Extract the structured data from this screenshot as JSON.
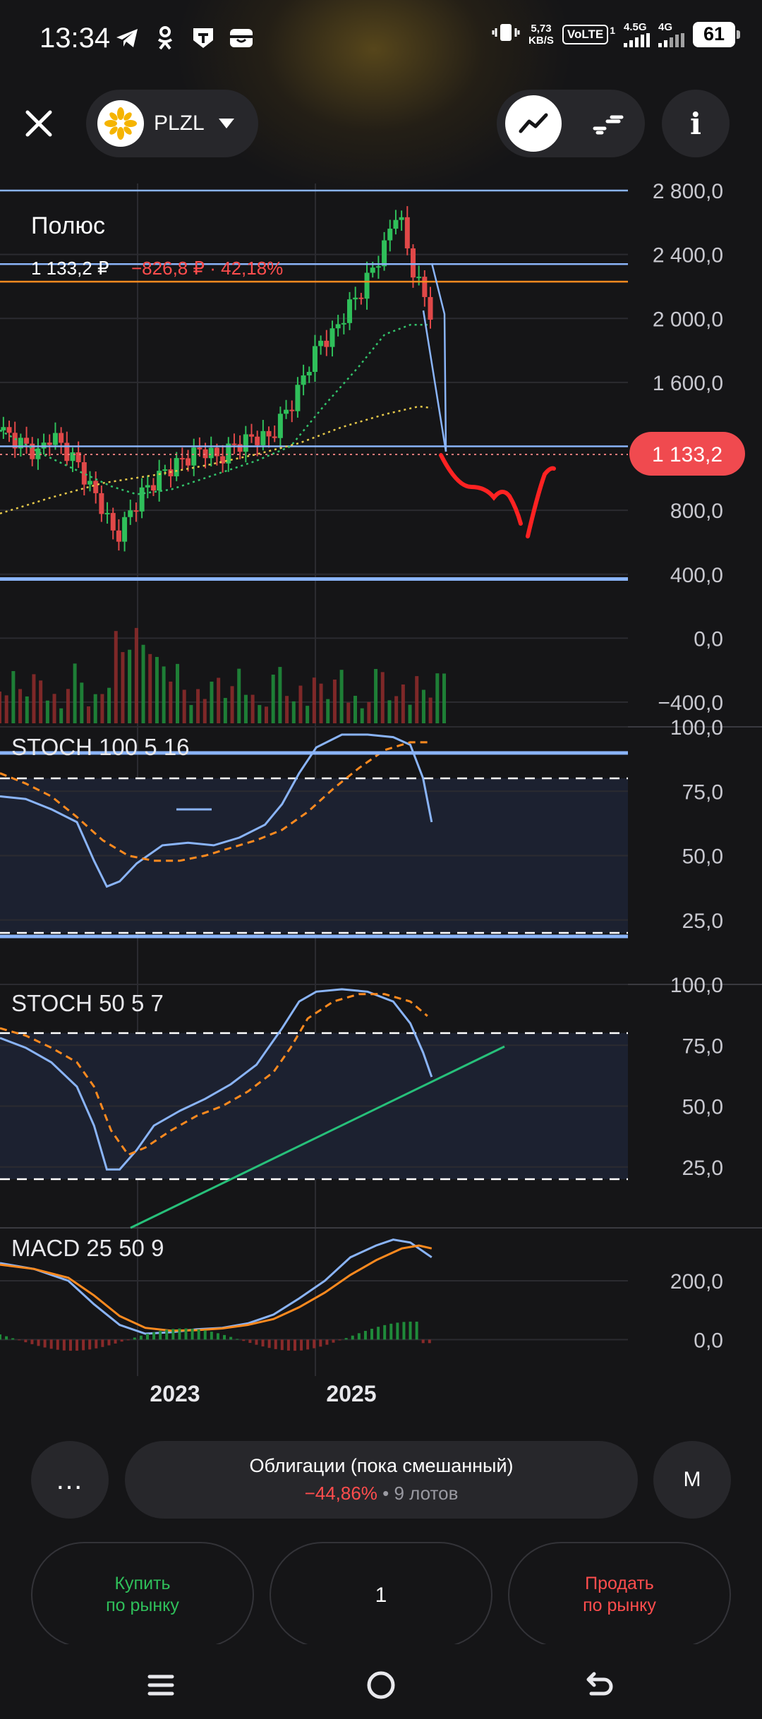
{
  "status_bar": {
    "time": "13:34",
    "net_speed_value": "5,73",
    "net_speed_unit": "KB/S",
    "volte": "VoLTE",
    "volte_sim": "1",
    "sig1_label": "4.5G",
    "sig2_label": "4G",
    "battery": "61"
  },
  "header": {
    "ticker": "PLZL"
  },
  "chart": {
    "title": "Полюс",
    "price": "1 133,2 ₽",
    "change": "−826,8 ₽ · 42,18%",
    "current_price_badge": "1 133,2",
    "colors": {
      "up": "#2fbf5a",
      "down": "#e04848",
      "accent_orange": "#ff8a1f",
      "line_blue": "#8ab4f8"
    }
  },
  "chart_data": [
    {
      "type": "candlestick",
      "title": "Полюс",
      "ylim": [
        -400,
        2800
      ],
      "y_ticks": [
        "2 800,0",
        "2 400,0",
        "2 000,0",
        "1 600,0",
        "1 200,0",
        "800,0",
        "400,0",
        "0,0",
        "−400,0"
      ],
      "x_ticks": [
        "2023",
        "2025"
      ],
      "close_series": [
        [
          0,
          1300
        ],
        [
          3,
          1250
        ],
        [
          6,
          1200
        ],
        [
          9,
          1150
        ],
        [
          12,
          1280
        ],
        [
          15,
          1180
        ],
        [
          18,
          1100
        ],
        [
          21,
          950
        ],
        [
          24,
          820
        ],
        [
          27,
          620
        ],
        [
          30,
          760
        ],
        [
          33,
          900
        ],
        [
          36,
          980
        ],
        [
          39,
          1050
        ],
        [
          42,
          1100
        ],
        [
          45,
          1150
        ],
        [
          48,
          1180
        ],
        [
          51,
          1120
        ],
        [
          54,
          1190
        ],
        [
          57,
          1230
        ],
        [
          60,
          1260
        ],
        [
          63,
          1250
        ],
        [
          66,
          1380
        ],
        [
          69,
          1500
        ],
        [
          72,
          1700
        ],
        [
          75,
          1850
        ],
        [
          78,
          1900
        ],
        [
          81,
          2050
        ],
        [
          84,
          2150
        ],
        [
          87,
          2300
        ],
        [
          90,
          2450
        ],
        [
          93,
          2700
        ],
        [
          96,
          2350
        ],
        [
          99,
          2150
        ],
        [
          102,
          1960
        ],
        [
          104,
          1133
        ]
      ],
      "horizontal_levels": [
        {
          "value": 2800,
          "color": "#8ab4f8"
        },
        {
          "value": 2340,
          "color": "#8ab4f8"
        },
        {
          "value": 2230,
          "color": "#ff8a1f"
        },
        {
          "value": 1200,
          "color": "#8ab4f8"
        },
        {
          "value": 370,
          "color": "#8ab4f8"
        }
      ]
    },
    {
      "type": "line",
      "title": "STOCH 100 5 16",
      "y_ticks": [
        "100,0",
        "75,0",
        "50,0",
        "25,0"
      ],
      "levels": [
        80,
        20
      ],
      "k": [
        [
          0,
          73
        ],
        [
          6,
          72
        ],
        [
          12,
          68
        ],
        [
          18,
          63
        ],
        [
          22,
          48
        ],
        [
          25,
          38
        ],
        [
          28,
          40
        ],
        [
          32,
          47
        ],
        [
          38,
          54
        ],
        [
          44,
          55
        ],
        [
          50,
          54
        ],
        [
          56,
          57
        ],
        [
          62,
          62
        ],
        [
          66,
          70
        ],
        [
          70,
          82
        ],
        [
          74,
          92
        ],
        [
          80,
          97
        ],
        [
          86,
          97
        ],
        [
          92,
          96
        ],
        [
          96,
          93
        ],
        [
          99,
          80
        ],
        [
          101,
          63
        ]
      ],
      "d": [
        [
          0,
          82
        ],
        [
          6,
          78
        ],
        [
          12,
          73
        ],
        [
          18,
          65
        ],
        [
          24,
          56
        ],
        [
          30,
          50
        ],
        [
          36,
          48
        ],
        [
          42,
          48
        ],
        [
          48,
          50
        ],
        [
          54,
          53
        ],
        [
          60,
          56
        ],
        [
          66,
          60
        ],
        [
          72,
          67
        ],
        [
          78,
          76
        ],
        [
          84,
          84
        ],
        [
          90,
          91
        ],
        [
          96,
          94
        ],
        [
          101,
          94
        ]
      ]
    },
    {
      "type": "line",
      "title": "STOCH 50 5 7",
      "y_ticks": [
        "100,0",
        "75,0",
        "50,0",
        "25,0"
      ],
      "levels": [
        80,
        20
      ],
      "k": [
        [
          0,
          78
        ],
        [
          6,
          74
        ],
        [
          12,
          68
        ],
        [
          18,
          58
        ],
        [
          22,
          42
        ],
        [
          25,
          24
        ],
        [
          28,
          24
        ],
        [
          32,
          32
        ],
        [
          36,
          42
        ],
        [
          42,
          48
        ],
        [
          48,
          53
        ],
        [
          54,
          59
        ],
        [
          60,
          67
        ],
        [
          66,
          82
        ],
        [
          70,
          93
        ],
        [
          74,
          97
        ],
        [
          80,
          98
        ],
        [
          86,
          97
        ],
        [
          92,
          93
        ],
        [
          96,
          84
        ],
        [
          99,
          72
        ],
        [
          101,
          62
        ]
      ],
      "d": [
        [
          0,
          82
        ],
        [
          6,
          79
        ],
        [
          12,
          74
        ],
        [
          18,
          68
        ],
        [
          22,
          58
        ],
        [
          26,
          40
        ],
        [
          30,
          30
        ],
        [
          34,
          33
        ],
        [
          40,
          40
        ],
        [
          46,
          46
        ],
        [
          52,
          50
        ],
        [
          58,
          56
        ],
        [
          64,
          64
        ],
        [
          68,
          74
        ],
        [
          72,
          86
        ],
        [
          78,
          93
        ],
        [
          84,
          96
        ],
        [
          90,
          96
        ],
        [
          96,
          93
        ],
        [
          100,
          87
        ]
      ]
    },
    {
      "type": "line",
      "title": "MACD 25 50 9",
      "y_ticks": [
        "200,0",
        "0,0"
      ],
      "macd": [
        [
          0,
          260
        ],
        [
          8,
          240
        ],
        [
          16,
          200
        ],
        [
          22,
          120
        ],
        [
          28,
          50
        ],
        [
          34,
          20
        ],
        [
          40,
          25
        ],
        [
          46,
          35
        ],
        [
          52,
          40
        ],
        [
          58,
          55
        ],
        [
          64,
          85
        ],
        [
          70,
          140
        ],
        [
          76,
          200
        ],
        [
          82,
          280
        ],
        [
          88,
          320
        ],
        [
          92,
          340
        ],
        [
          96,
          330
        ],
        [
          101,
          280
        ]
      ],
      "signal": [
        [
          0,
          255
        ],
        [
          8,
          240
        ],
        [
          16,
          210
        ],
        [
          22,
          150
        ],
        [
          28,
          80
        ],
        [
          34,
          40
        ],
        [
          40,
          30
        ],
        [
          46,
          32
        ],
        [
          52,
          38
        ],
        [
          58,
          50
        ],
        [
          64,
          70
        ],
        [
          70,
          110
        ],
        [
          76,
          160
        ],
        [
          82,
          220
        ],
        [
          88,
          270
        ],
        [
          94,
          310
        ],
        [
          98,
          320
        ],
        [
          101,
          310
        ]
      ]
    }
  ],
  "bottom": {
    "more_label": "…",
    "portfolio_name": "Облигации (пока смешанный)",
    "portfolio_pct": "−44,86%",
    "portfolio_sep": " • ",
    "portfolio_lots": "9 лотов",
    "m_label": "M",
    "buy_line1": "Купить",
    "buy_line2": "по рынку",
    "quantity": "1",
    "sell_line1": "Продать",
    "sell_line2": "по рынку"
  }
}
